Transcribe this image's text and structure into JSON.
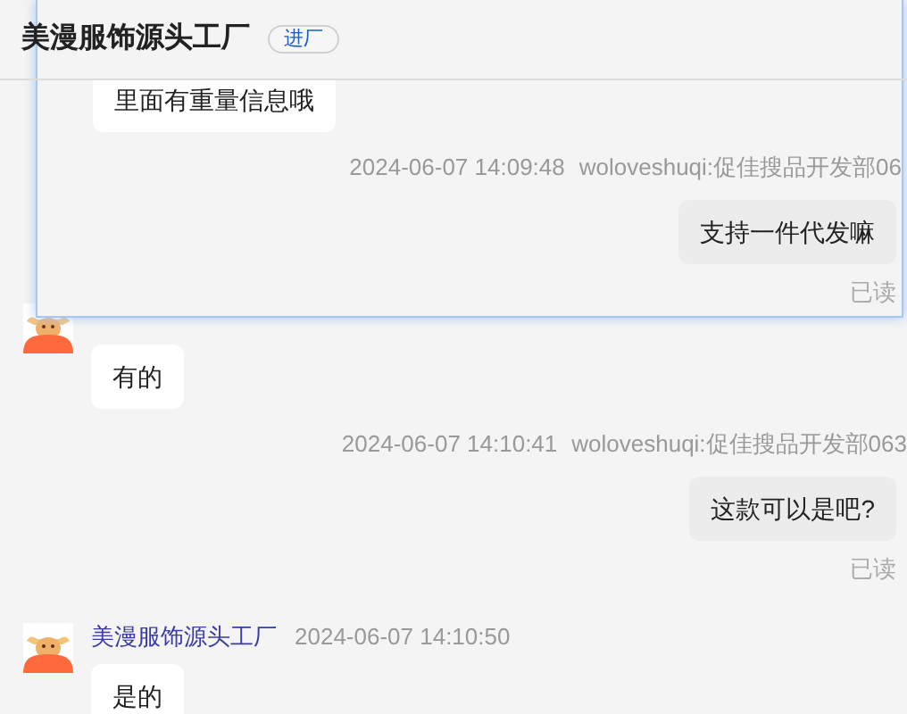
{
  "header": {
    "title": "美漫服饰源头工厂",
    "badge": "进厂"
  },
  "panel": {
    "messages": [
      {
        "kind": "incoming",
        "text": "里面有重量信息哦"
      },
      {
        "kind": "outgoing",
        "time": "2024-06-07 14:09:48",
        "account": "woloveshuqi:促佳搜品开发部06",
        "text": "支持一件代发嘛",
        "status": "已读"
      }
    ]
  },
  "messages": [
    {
      "kind": "incoming",
      "text": "有的"
    },
    {
      "kind": "outgoing",
      "time": "2024-06-07 14:10:41",
      "account": "woloveshuqi:促佳搜品开发部063",
      "text": "这款可以是吧?",
      "status": "已读"
    },
    {
      "kind": "incoming",
      "sender": "美漫服饰源头工厂",
      "time": "2024-06-07 14:10:50",
      "text": "是的"
    }
  ]
}
